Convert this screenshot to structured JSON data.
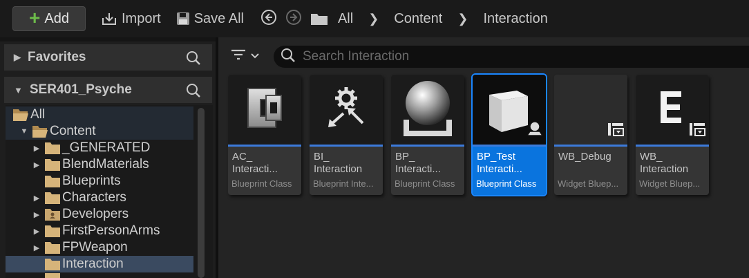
{
  "toolbar": {
    "add_label": "Add",
    "import_label": "Import",
    "save_all_label": "Save All"
  },
  "breadcrumb": [
    "All",
    "Content",
    "Interaction"
  ],
  "left_panel": {
    "favorites_label": "Favorites",
    "project_label": "SER401_Psyche",
    "tree": [
      {
        "label": "All",
        "expanded": true,
        "level": 0
      },
      {
        "label": "Content",
        "expanded": true,
        "level": 1
      },
      {
        "label": "_GENERATED",
        "expanded": false,
        "level": 2
      },
      {
        "label": "BlendMaterials",
        "expanded": false,
        "level": 2
      },
      {
        "label": "Blueprints",
        "expanded": null,
        "level": 2
      },
      {
        "label": "Characters",
        "expanded": false,
        "level": 2
      },
      {
        "label": "Developers",
        "expanded": false,
        "level": 2
      },
      {
        "label": "FirstPersonArms",
        "expanded": false,
        "level": 2
      },
      {
        "label": "FPWeapon",
        "expanded": false,
        "level": 2
      },
      {
        "label": "Interaction",
        "expanded": null,
        "level": 2,
        "selected": true
      }
    ]
  },
  "search": {
    "placeholder": "Search Interaction"
  },
  "assets": [
    {
      "name": "AC_ Interacti...",
      "type": "Blueprint Class",
      "icon": "actor-component-icon",
      "stripe": "#3c7bdb"
    },
    {
      "name": "BI_ Interaction",
      "type": "Blueprint Inte...",
      "icon": "blueprint-interface-icon",
      "stripe": "#3c7bdb"
    },
    {
      "name": "BP_ Interacti...",
      "type": "Blueprint Class",
      "icon": "sphere-actor-icon",
      "stripe": "#3c7bdb"
    },
    {
      "name": "BP_Test Interacti...",
      "type": "Blueprint Class",
      "icon": "cube-icon",
      "stripe": "#3c7bdb",
      "selected": true
    },
    {
      "name": "WB_Debug",
      "type": "Widget Bluep...",
      "icon": "widget-blueprint-icon",
      "stripe": "#3c7bdb"
    },
    {
      "name": "WB_ Interaction",
      "type": "Widget Bluep...",
      "icon": "widget-blueprint-letter-icon",
      "stripe": "#3c7bdb"
    }
  ],
  "colors": {
    "accent": "#0a74de",
    "add_plus": "#6dbb4a",
    "folder": "#d6b47a"
  }
}
